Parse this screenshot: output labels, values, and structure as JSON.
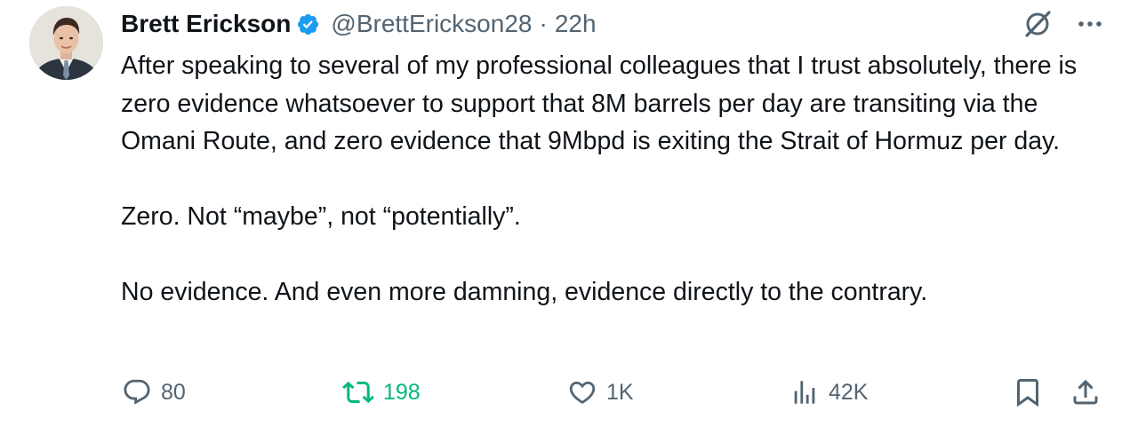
{
  "author": {
    "display_name": "Brett Erickson",
    "verified": true,
    "handle": "@BrettErickson28",
    "separator": "·",
    "time": "22h"
  },
  "tweet": {
    "paragraphs": [
      "After speaking to several of my professional colleagues that I trust absolutely, there is zero evidence whatsoever to support that 8M barrels per day are transiting via the Omani Route, and zero evidence that 9Mbpd is exiting the Strait of Hormuz per day.",
      "Zero. Not “maybe”, not “potentially”.",
      "No evidence. And even more damning, evidence directly to the contrary."
    ]
  },
  "actions": {
    "replies": "80",
    "reposts": "198",
    "likes": "1K",
    "views": "42K"
  },
  "icons": {
    "header": [
      "grok-icon",
      "more-icon"
    ],
    "actions": [
      "reply-icon",
      "repost-icon",
      "like-icon",
      "views-icon",
      "bookmark-icon",
      "share-icon"
    ]
  },
  "colors": {
    "text": "#0f1419",
    "secondary": "#536471",
    "verified_blue": "#1d9bf0",
    "repost_green": "#00ba7c"
  }
}
